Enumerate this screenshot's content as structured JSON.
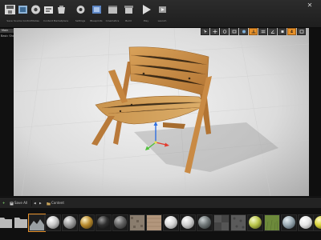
{
  "toolbar": {
    "items": [
      {
        "label": "Save",
        "icon": "save-icon"
      },
      {
        "label": "Source Control",
        "icon": "source-control-icon"
      },
      {
        "label": "Modes",
        "icon": "modes-icon"
      },
      {
        "label": "Content",
        "icon": "content-icon"
      },
      {
        "label": "Marketplace",
        "icon": "marketplace-icon"
      },
      {
        "label": "Settings",
        "icon": "settings-icon"
      },
      {
        "label": "Blueprints",
        "icon": "blueprints-icon"
      },
      {
        "label": "Cinematics",
        "icon": "cinematics-icon"
      },
      {
        "label": "Build",
        "icon": "build-icon"
      },
      {
        "label": "Play",
        "icon": "play-icon"
      },
      {
        "label": "Launch",
        "icon": "launch-icon"
      }
    ],
    "close_glyph": "✕"
  },
  "left_panel": {
    "tab": "Main",
    "label": "Basic Shapes"
  },
  "viewport": {
    "camera_speed": "4"
  },
  "content_browser": {
    "save_all": "Save All",
    "back_glyph": "◀",
    "forward_glyph": "▶",
    "path_root": "Content",
    "add_glyph": "+"
  },
  "assets": {
    "thumbnails": [
      {
        "kind": "folder"
      },
      {
        "kind": "folder"
      },
      {
        "kind": "terrain"
      },
      {
        "kind": "sphere",
        "color": "#c8c8c8"
      },
      {
        "kind": "sphere",
        "color": "#9a9a9a"
      },
      {
        "kind": "sphere",
        "color": "#b88a2d"
      },
      {
        "kind": "sphere",
        "color": "#2f2f2f"
      },
      {
        "kind": "sphere",
        "color": "#606060"
      },
      {
        "kind": "tile",
        "color": "#8a7d6e"
      },
      {
        "kind": "tile",
        "color": "#b2967c"
      },
      {
        "kind": "sphere",
        "color": "#d8d8d8"
      },
      {
        "kind": "sphere",
        "color": "#cfcfcf"
      },
      {
        "kind": "sphere",
        "color": "#6f7677"
      },
      {
        "kind": "tile",
        "color": "#444"
      },
      {
        "kind": "tile",
        "color": "#5a5a5a"
      },
      {
        "kind": "sphere",
        "color": "#b9c44a"
      },
      {
        "kind": "tile",
        "color": "#6d8a3b"
      },
      {
        "kind": "sphere",
        "color": "#9aa9b2"
      },
      {
        "kind": "sphere",
        "color": "#e6e6e6"
      },
      {
        "kind": "sphere",
        "color": "#d7d23a"
      }
    ]
  },
  "colors": {
    "accent": "#e7912a",
    "floor_light": "#ececec",
    "floor_dark": "#a9a9a9",
    "wood": "#c68a42",
    "gizmo_x": "#e23b2e",
    "gizmo_y": "#4fbf3a",
    "gizmo_z": "#2f6fe0"
  }
}
